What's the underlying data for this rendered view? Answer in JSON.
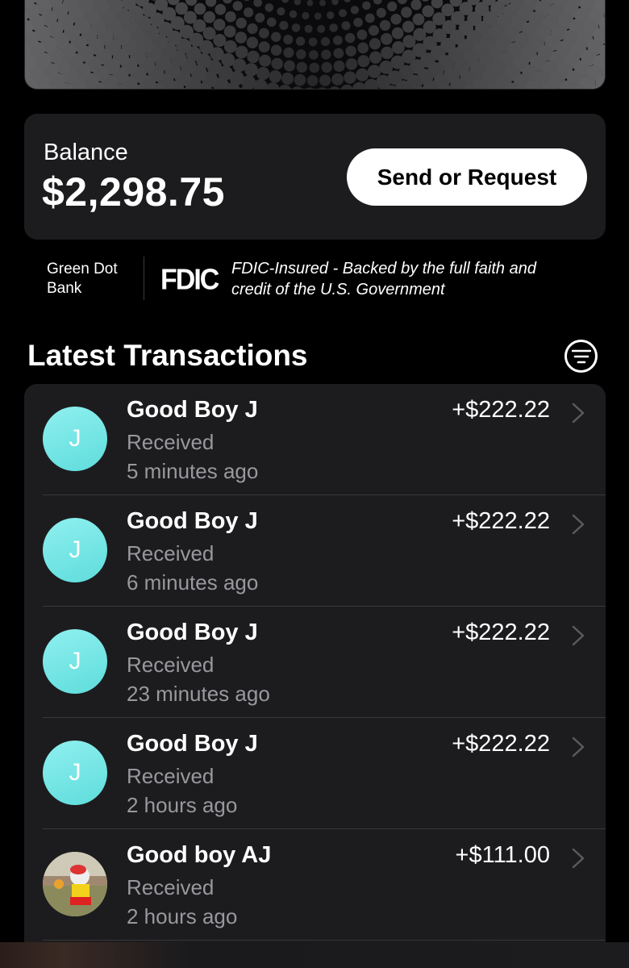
{
  "balance": {
    "label": "Balance",
    "amount": "$2,298.75",
    "send_label": "Send or Request"
  },
  "fdic": {
    "bank": "Green Dot Bank",
    "logo": "FDIC",
    "text": "FDIC-Insured - Backed by the full faith and credit of the U.S. Government"
  },
  "transactions": {
    "title": "Latest Transactions",
    "filter_icon": "filter-icon",
    "items": [
      {
        "initial": "J",
        "name": "Good Boy J",
        "status": "Received",
        "time": "5 minutes ago",
        "amount": "+$222.22"
      },
      {
        "initial": "J",
        "name": "Good Boy J",
        "status": "Received",
        "time": "6 minutes ago",
        "amount": "+$222.22"
      },
      {
        "initial": "J",
        "name": "Good Boy J",
        "status": "Received",
        "time": "23 minutes ago",
        "amount": "+$222.22"
      },
      {
        "initial": "J",
        "name": "Good Boy J",
        "status": "Received",
        "time": "2 hours ago",
        "amount": "+$222.22"
      },
      {
        "initial": "",
        "name": "Good boy AJ",
        "status": "Received",
        "time": "2 hours ago",
        "amount": "+$111.00"
      }
    ]
  },
  "colors": {
    "background": "#000000",
    "card": "#1c1c1e",
    "secondary_text": "#98989d",
    "avatar": "#6fe3e3"
  }
}
